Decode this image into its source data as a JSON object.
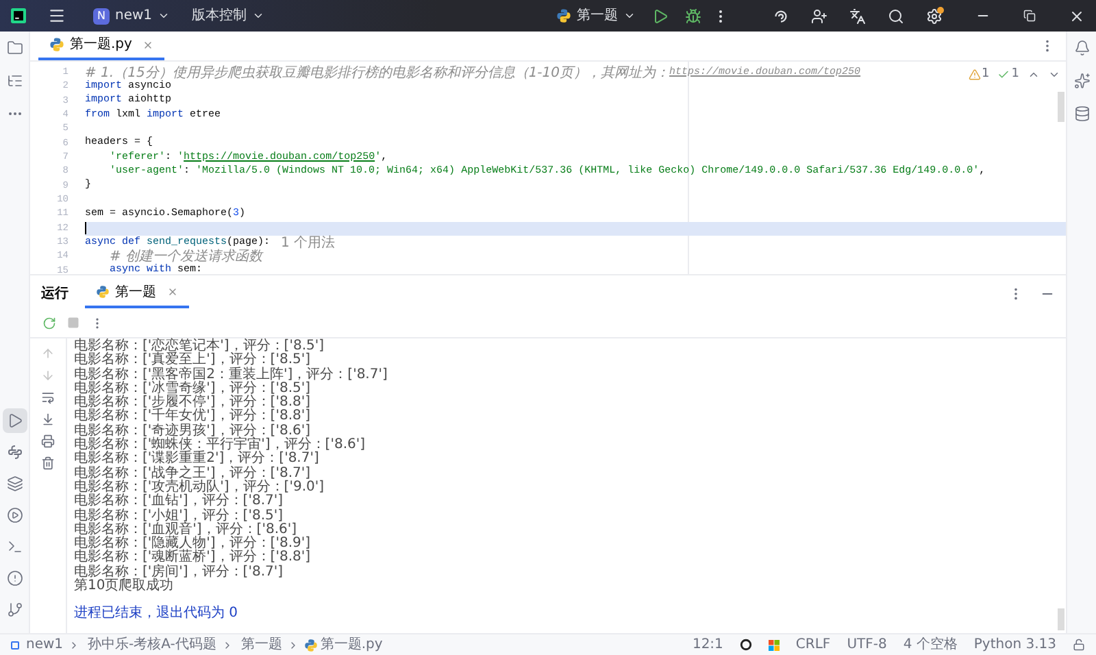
{
  "title_bar": {
    "project_badge": "N",
    "project": "new1",
    "vcs": "版本控制",
    "run_config": "第一题",
    "settings_update": true
  },
  "left_toolbar": [
    {
      "kind": "run",
      "selected": true
    },
    {
      "kind": "console",
      "selected": false
    },
    {
      "kind": "packages",
      "selected": false
    },
    {
      "kind": "services",
      "selected": false
    },
    {
      "kind": "terminal",
      "selected": false
    },
    {
      "kind": "problems",
      "selected": false
    },
    {
      "kind": "git",
      "selected": false
    }
  ],
  "editor": {
    "tabs": [
      {
        "label": "第一题.py",
        "selected": true
      }
    ],
    "inspections": {
      "warnings": "1",
      "ok": "1"
    },
    "lines": [
      {
        "number": "1",
        "current": false,
        "segments": [
          {
            "kind": "comment",
            "text": "# 1.（15分）使用异步爬虫获取豆瓣电影排行榜的电影名称和评分信息（1-10页），其网址为："
          },
          {
            "kind": "comment_link",
            "text": "https://movie.douban.com/top250"
          }
        ]
      },
      {
        "number": "2",
        "current": false,
        "segments": [
          {
            "kind": "keyword",
            "text": "import"
          },
          {
            "kind": "plain",
            "text": " asyncio"
          }
        ]
      },
      {
        "number": "3",
        "current": false,
        "segments": [
          {
            "kind": "keyword",
            "text": "import"
          },
          {
            "kind": "plain",
            "text": " aiohttp"
          }
        ]
      },
      {
        "number": "4",
        "current": false,
        "segments": [
          {
            "kind": "keyword",
            "text": "from"
          },
          {
            "kind": "plain",
            "text": " lxml "
          },
          {
            "kind": "keyword",
            "text": "import"
          },
          {
            "kind": "plain",
            "text": " etree"
          }
        ]
      },
      {
        "number": "5",
        "current": false
      },
      {
        "number": "6",
        "current": false,
        "segments": [
          {
            "kind": "plain",
            "text": "headers = {"
          }
        ]
      },
      {
        "number": "7",
        "current": false,
        "indented": true,
        "segments": [
          {
            "kind": "string",
            "text": "'referer'"
          },
          {
            "kind": "plain",
            "text": ": "
          },
          {
            "kind": "string",
            "text": "'"
          },
          {
            "kind": "string_link",
            "text": "https://movie.douban.com/top250"
          },
          {
            "kind": "string",
            "text": "'"
          },
          {
            "kind": "plain",
            "text": ","
          }
        ]
      },
      {
        "number": "8",
        "current": false,
        "indented": true,
        "segments": [
          {
            "kind": "string",
            "text": "'user-agent'"
          },
          {
            "kind": "plain",
            "text": ": "
          },
          {
            "kind": "string",
            "text": "'Mozilla/5.0 (Windows NT 10.0; Win64; x64) AppleWebKit/537.36 (KHTML, like Gecko) Chrome/149.0.0.0 Safari/537.36 Edg/149.0.0.0'"
          },
          {
            "kind": "plain",
            "text": ","
          }
        ]
      },
      {
        "number": "9",
        "current": false,
        "segments": [
          {
            "kind": "plain",
            "text": "}"
          }
        ]
      },
      {
        "number": "10",
        "current": false
      },
      {
        "number": "11",
        "current": false,
        "segments": [
          {
            "kind": "plain",
            "text": "sem = asyncio.Semaphore("
          },
          {
            "kind": "number",
            "text": "3"
          },
          {
            "kind": "plain",
            "text": ")"
          }
        ]
      },
      {
        "number": "12",
        "current": true
      },
      {
        "number": "13",
        "current": false,
        "segments": [
          {
            "kind": "keyword",
            "text": "async def"
          },
          {
            "kind": "function",
            "text": " send_requests"
          },
          {
            "kind": "plain",
            "text": "(page):"
          },
          {
            "kind": "hint",
            "text": "1 个用法"
          }
        ]
      },
      {
        "number": "14",
        "current": false,
        "indented": true,
        "segments": [
          {
            "kind": "comment",
            "text": "# 创建一个发送请求函数"
          }
        ]
      },
      {
        "number": "15",
        "current": false,
        "indented": true,
        "segments": [
          {
            "kind": "keyword",
            "text": "async with"
          },
          {
            "kind": "plain",
            "text": " sem:"
          }
        ]
      }
    ]
  },
  "run_panel": {
    "title": "运行",
    "tabs": [
      {
        "label": "第一题",
        "selected": true
      }
    ],
    "output": [
      {
        "kind": "stdout",
        "text": "电影名称：['恋恋笔记本']，评分：['8.5']"
      },
      {
        "kind": "stdout",
        "text": "电影名称：['真爱至上']，评分：['8.5']"
      },
      {
        "kind": "stdout",
        "text": "电影名称：['黑客帝国2：重装上阵']，评分：['8.7']"
      },
      {
        "kind": "stdout",
        "text": "电影名称：['冰雪奇缘']，评分：['8.5']"
      },
      {
        "kind": "stdout",
        "text": "电影名称：['步履不停']，评分：['8.8']"
      },
      {
        "kind": "stdout",
        "text": "电影名称：['千年女优']，评分：['8.8']"
      },
      {
        "kind": "stdout",
        "text": "电影名称：['奇迹男孩']，评分：['8.6']"
      },
      {
        "kind": "stdout",
        "text": "电影名称：['蜘蛛侠：平行宇宙']，评分：['8.6']"
      },
      {
        "kind": "stdout",
        "text": "电影名称：['谍影重重2']，评分：['8.7']"
      },
      {
        "kind": "stdout",
        "text": "电影名称：['战争之王']，评分：['8.7']"
      },
      {
        "kind": "stdout",
        "text": "电影名称：['攻壳机动队']，评分：['9.0']"
      },
      {
        "kind": "stdout",
        "text": "电影名称：['血钻']，评分：['8.7']"
      },
      {
        "kind": "stdout",
        "text": "电影名称：['小姐']，评分：['8.5']"
      },
      {
        "kind": "stdout",
        "text": "电影名称：['血观音']，评分：['8.6']"
      },
      {
        "kind": "stdout",
        "text": "电影名称：['隐藏人物']，评分：['8.9']"
      },
      {
        "kind": "stdout",
        "text": "电影名称：['魂断蓝桥']，评分：['8.8']"
      },
      {
        "kind": "stdout",
        "text": "电影名称：['房间']，评分：['8.7']"
      },
      {
        "kind": "stdout",
        "text": "第10页爬取成功"
      },
      {
        "kind": "exit",
        "text": "进程已结束，退出代码为 0"
      }
    ]
  },
  "breadcrumbs": [
    "new1",
    "孙中乐-考核A-代码题",
    "第一题",
    "第一题.py"
  ],
  "status_bar": {
    "position": "12:1",
    "line_separator": "CRLF",
    "encoding": "UTF-8",
    "indent": "4 个空格",
    "interpreter": "Python 3.13"
  }
}
